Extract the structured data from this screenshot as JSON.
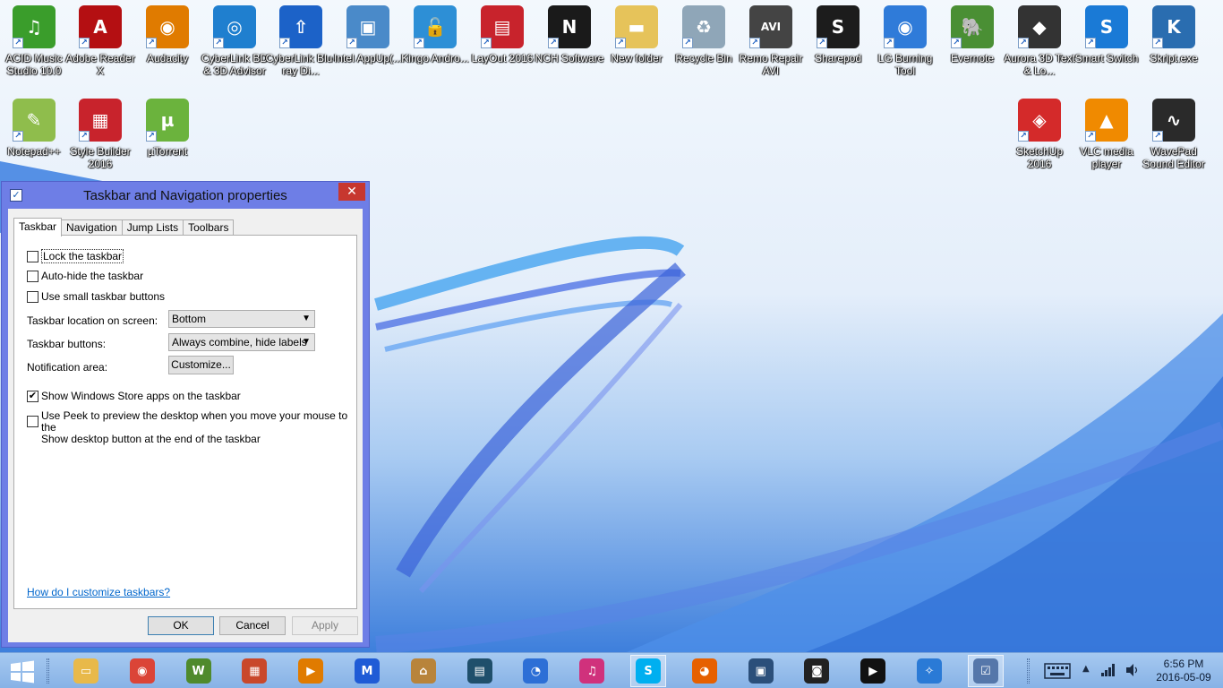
{
  "desktop": {
    "icons": [
      {
        "label": "ACID Music Studio 10.0",
        "glyph": "♫",
        "color": "#3a9d2b",
        "icon": "music-note-icon"
      },
      {
        "label": "Adobe Reader X",
        "glyph": "A",
        "color": "#b40f12",
        "icon": "pdf-reader-icon"
      },
      {
        "label": "Audacity",
        "glyph": "◉",
        "color": "#e07b00",
        "icon": "headphones-icon"
      },
      {
        "label": "CyberLink BD & 3D Advisor",
        "glyph": "◎",
        "color": "#1f7fcf",
        "icon": "disc-check-icon"
      },
      {
        "label": "CyberLink Blu-ray Di...",
        "glyph": "⇧",
        "color": "#1c62c8",
        "icon": "disc-upload-icon"
      },
      {
        "label": "Intel AppUp(...",
        "glyph": "▣",
        "color": "#4a8ac9",
        "icon": "intel-appup-icon"
      },
      {
        "label": "Kingo Andro...",
        "glyph": "🔓",
        "color": "#2d8fd6",
        "icon": "unlock-icon"
      },
      {
        "label": "LayOut 2016",
        "glyph": "▤",
        "color": "#c8232c",
        "icon": "layout-icon"
      },
      {
        "label": "NCH Software",
        "glyph": "N",
        "color": "#1a1a1a",
        "icon": "nch-logo-icon"
      },
      {
        "label": "New folder",
        "glyph": "▬",
        "color": "#e6c35a",
        "icon": "folder-icon"
      },
      {
        "label": "Recycle Bin",
        "glyph": "♻",
        "color": "#8fa6b8",
        "icon": "recycle-bin-icon"
      },
      {
        "label": "Remo Repair AVI",
        "glyph": "AVI",
        "color": "#444",
        "icon": "video-repair-icon"
      },
      {
        "label": "Sharepod",
        "glyph": "S",
        "color": "#1c1c1c",
        "icon": "sharepod-icon"
      },
      {
        "label": "LG Burning Tool",
        "glyph": "◉",
        "color": "#2f7bd9",
        "icon": "burning-disc-icon"
      },
      {
        "label": "Evernote",
        "glyph": "🐘",
        "color": "#4a8f34",
        "icon": "evernote-icon"
      },
      {
        "label": "Aurora 3D Text & Lo...",
        "glyph": "◆",
        "color": "#333",
        "icon": "aurora-3d-icon"
      },
      {
        "label": "Smart Switch",
        "glyph": "S",
        "color": "#1a7ad6",
        "icon": "smart-switch-icon"
      },
      {
        "label": "Skript.exe",
        "glyph": "K",
        "color": "#2a6db0",
        "icon": "skript-icon"
      },
      {
        "label": "Notepad++",
        "glyph": "✎",
        "color": "#8fbd4c",
        "icon": "notepad-plus-icon"
      },
      {
        "label": "Style Builder 2016",
        "glyph": "▦",
        "color": "#c8232c",
        "icon": "style-builder-icon"
      },
      {
        "label": "µTorrent",
        "glyph": "µ",
        "color": "#6bb33d",
        "icon": "utorrent-icon"
      },
      {
        "label": "SketchUp 2016",
        "glyph": "◈",
        "color": "#d42a2a",
        "icon": "sketchup-icon"
      },
      {
        "label": "VLC media player",
        "glyph": "▲",
        "color": "#f08a00",
        "icon": "vlc-cone-icon"
      },
      {
        "label": "WavePad Sound Editor",
        "glyph": "∿",
        "color": "#2a2a2a",
        "icon": "waveform-icon"
      }
    ]
  },
  "dialog": {
    "title": "Taskbar and Navigation properties",
    "close_glyph": "✕",
    "tabs": [
      {
        "label": "Taskbar",
        "active": true
      },
      {
        "label": "Navigation",
        "active": false
      },
      {
        "label": "Jump Lists",
        "active": false
      },
      {
        "label": "Toolbars",
        "active": false
      }
    ],
    "lock_taskbar": {
      "label": "Lock the taskbar",
      "checked": false
    },
    "auto_hide": {
      "label": "Auto-hide the taskbar",
      "checked": false
    },
    "small_buttons": {
      "label": "Use small taskbar buttons",
      "checked": false
    },
    "location": {
      "label": "Taskbar location on screen:",
      "value": "Bottom"
    },
    "buttons": {
      "label": "Taskbar buttons:",
      "value": "Always combine, hide labels"
    },
    "notification": {
      "label": "Notification area:",
      "button": "Customize..."
    },
    "store_apps": {
      "label": "Show Windows Store apps on the taskbar",
      "checked": true
    },
    "peek": {
      "line1": "Use Peek to preview the desktop when you move your mouse to the",
      "line2": "Show desktop button at the end of the taskbar",
      "checked": false
    },
    "help_link": "How do I customize taskbars?",
    "ok": "OK",
    "cancel": "Cancel",
    "apply": "Apply"
  },
  "taskbar": {
    "apps": [
      {
        "name": "file-explorer",
        "glyph": "▭",
        "color": "#e8b94a",
        "active": false
      },
      {
        "name": "chrome",
        "glyph": "◉",
        "color": "#db4437",
        "active": false
      },
      {
        "name": "winamp",
        "glyph": "W",
        "color": "#4f8a2c",
        "active": false
      },
      {
        "name": "photo-app",
        "glyph": "▦",
        "color": "#c9482b",
        "active": false
      },
      {
        "name": "media-player",
        "glyph": "▶",
        "color": "#e07b00",
        "active": false
      },
      {
        "name": "malwarebytes",
        "glyph": "M",
        "color": "#1f5bd6",
        "active": false
      },
      {
        "name": "temple-app",
        "glyph": "⌂",
        "color": "#b8843b",
        "active": false
      },
      {
        "name": "film-app",
        "glyph": "▤",
        "color": "#1f4f6b",
        "active": false
      },
      {
        "name": "bird-app",
        "glyph": "◔",
        "color": "#2d6fd6",
        "active": false
      },
      {
        "name": "itunes",
        "glyph": "♫",
        "color": "#d0317c",
        "active": false
      },
      {
        "name": "skype",
        "glyph": "S",
        "color": "#00aff0",
        "active": true
      },
      {
        "name": "firefox",
        "glyph": "◕",
        "color": "#e66000",
        "active": false
      },
      {
        "name": "remote-desktop",
        "glyph": "▣",
        "color": "#2b4f7a",
        "active": false
      },
      {
        "name": "webcam-app",
        "glyph": "◙",
        "color": "#222",
        "active": false
      },
      {
        "name": "media-play",
        "glyph": "▶",
        "color": "#111",
        "active": false
      },
      {
        "name": "safari",
        "glyph": "✧",
        "color": "#2a7ad6",
        "active": false
      },
      {
        "name": "properties-window",
        "glyph": "☑",
        "color": "#5577aa",
        "active": true
      }
    ],
    "time": "6:56 PM",
    "date": "2016-05-09"
  }
}
